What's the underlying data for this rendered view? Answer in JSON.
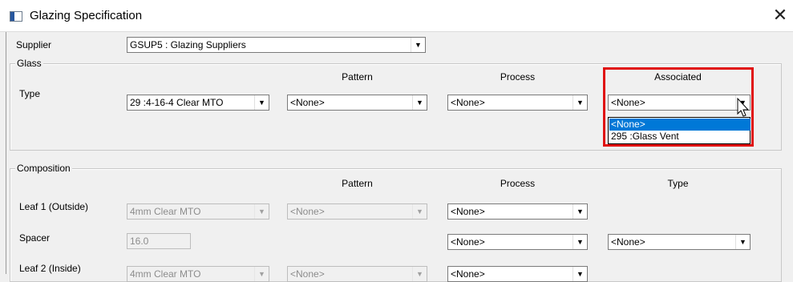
{
  "window": {
    "title": "Glazing Specification",
    "close_glyph": "✕",
    "icon": "window-app-icon"
  },
  "supplier": {
    "label": "Supplier",
    "value": "GSUP5 : Glazing Suppliers"
  },
  "glass": {
    "group_label": "Glass",
    "headers": {
      "pattern": "Pattern",
      "process": "Process",
      "associated": "Associated"
    },
    "type_label": "Type",
    "type_value": "29  :4-16-4 Clear MTO",
    "pattern_value": "<None>",
    "process_value": "<None>",
    "associated_value": "<None>",
    "associated_options": [
      "<None>",
      "295 :Glass Vent"
    ],
    "associated_selected": "<None>"
  },
  "composition": {
    "group_label": "Composition",
    "headers": {
      "pattern": "Pattern",
      "process": "Process",
      "type": "Type"
    },
    "leaf1": {
      "label": "Leaf 1 (Outside)",
      "glass_value": "4mm Clear MTO",
      "pattern_value": "<None>",
      "process_value": "<None>"
    },
    "spacer": {
      "label": "Spacer",
      "value": "16.0",
      "process_value": "<None>",
      "type_value": "<None>"
    },
    "leaf2": {
      "label": "Leaf 2 (Inside)",
      "glass_value": "4mm Clear MTO",
      "pattern_value": "<None>",
      "process_value": "<None>"
    }
  },
  "colors": {
    "highlight": "#e01010",
    "selection": "#0078d7"
  },
  "dropdown_arrow": "▼"
}
